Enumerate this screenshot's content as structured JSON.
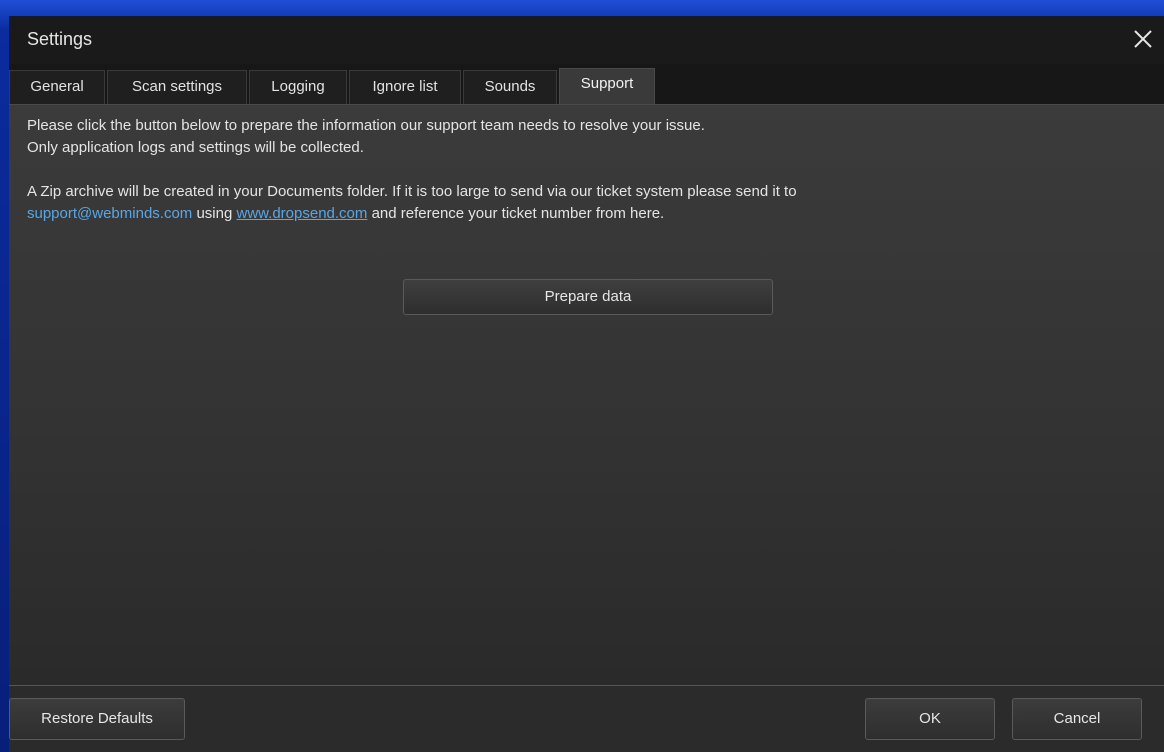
{
  "window": {
    "title": "Settings"
  },
  "tabs": [
    {
      "label": "General"
    },
    {
      "label": "Scan settings"
    },
    {
      "label": "Logging"
    },
    {
      "label": "Ignore list"
    },
    {
      "label": "Sounds"
    },
    {
      "label": "Support",
      "active": true
    }
  ],
  "support": {
    "line1": "Please click the button below to prepare the information our support team needs to resolve your issue.",
    "line2": "Only application logs and settings will be collected.",
    "line3": "A Zip archive will be created in your Documents folder. If it is too large to send via our ticket system please send it to",
    "email_link": "support@webminds.com",
    "using_text": " using ",
    "dropsend_link": "www.dropsend.com",
    "reference_text": " and reference your ticket number from here.",
    "prepare_label": "Prepare data"
  },
  "footer": {
    "restore_label": "Restore Defaults",
    "ok_label": "OK",
    "cancel_label": "Cancel"
  },
  "colors": {
    "link": "#58a6e6",
    "background": "#2c2c2c",
    "titlebar": "#1a1a1a"
  },
  "icons": {
    "close": "close-icon"
  }
}
